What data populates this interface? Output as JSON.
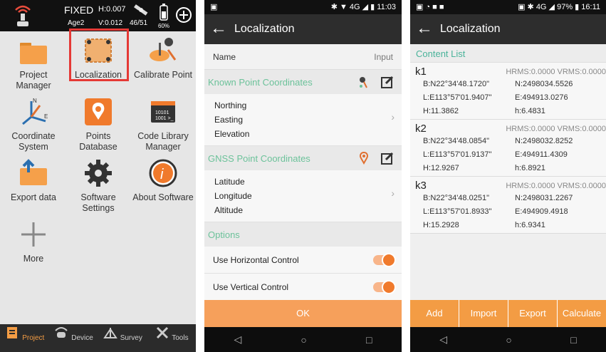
{
  "colors": {
    "accent": "#f39c44",
    "section_green": "#6cc29a",
    "selection_red": "#e53935"
  },
  "panel1": {
    "status": {
      "fix": "FIXED",
      "h": "H:0.007",
      "age": "Age2",
      "v": "V:0.012",
      "sats": "46/51",
      "battery": "60%"
    },
    "grid": [
      {
        "label": "Project Manager",
        "icon": "folder-icon"
      },
      {
        "label": "Localization",
        "icon": "map-localization-icon",
        "selected": true
      },
      {
        "label": "Calibrate Point",
        "icon": "calibrate-point-icon"
      },
      {
        "label": "Coordinate System",
        "icon": "coordinate-axes-icon"
      },
      {
        "label": "Points Database",
        "icon": "location-pin-icon"
      },
      {
        "label": "Code Library Manager",
        "icon": "code-library-icon"
      },
      {
        "label": "Export data",
        "icon": "export-folder-icon"
      },
      {
        "label": "Software Settings",
        "icon": "gear-icon"
      },
      {
        "label": "About Software",
        "icon": "info-icon"
      },
      {
        "label": "More",
        "icon": "plus-icon"
      }
    ],
    "tabs": [
      {
        "label": "Project",
        "icon": "project-icon",
        "active": true
      },
      {
        "label": "Device",
        "icon": "device-icon"
      },
      {
        "label": "Survey",
        "icon": "survey-icon"
      },
      {
        "label": "Tools",
        "icon": "tools-icon"
      }
    ]
  },
  "panel2": {
    "status_time": "11:03",
    "status_net": "4G",
    "title": "Localization",
    "name_label": "Name",
    "name_placeholder": "Input",
    "known_section": "Known Point Coordinates",
    "known_fields": [
      "Northing",
      "Easting",
      "Elevation"
    ],
    "gnss_section": "GNSS Point Coordinates",
    "gnss_fields": [
      "Latitude",
      "Longitude",
      "Altitude"
    ],
    "options_section": "Options",
    "options": [
      {
        "label": "Use Horizontal Control",
        "on": true
      },
      {
        "label": "Use Vertical Control",
        "on": true
      }
    ],
    "ok": "OK"
  },
  "panel3": {
    "status_time": "16:11",
    "status_battery": "97%",
    "status_net": "4G",
    "title": "Localization",
    "content_list": "Content List",
    "points": [
      {
        "name": "k1",
        "hv": "HRMS:0.0000 VRMS:0.0000",
        "b": "B:N22°34'48.1720\"",
        "n": "N:2498034.5526",
        "l": "L:E113°57'01.9407\"",
        "e": "E:494913.0276",
        "H": "H:11.3862",
        "h": "h:6.4831"
      },
      {
        "name": "k2",
        "hv": "HRMS:0.0000 VRMS:0.0000",
        "b": "B:N22°34'48.0854\"",
        "n": "N:2498032.8252",
        "l": "L:E113°57'01.9137\"",
        "e": "E:494911.4309",
        "H": "H:12.9267",
        "h": "h:6.8921"
      },
      {
        "name": "k3",
        "hv": "HRMS:0.0000 VRMS:0.0000",
        "b": "B:N22°34'48.0251\"",
        "n": "N:2498031.2267",
        "l": "L:E113°57'01.8933\"",
        "e": "E:494909.4918",
        "H": "H:15.2928",
        "h": "h:6.9341"
      }
    ],
    "buttons": [
      "Add",
      "Import",
      "Export",
      "Calculate"
    ]
  }
}
